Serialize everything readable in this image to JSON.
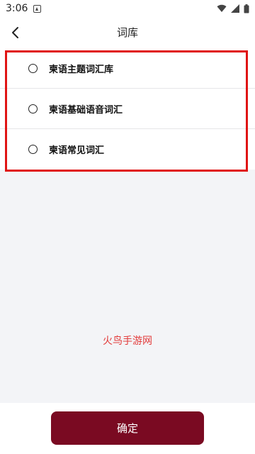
{
  "status_bar": {
    "time": "3:06",
    "icons": [
      "app-notification-icon",
      "wifi-icon",
      "signal-icon",
      "battery-icon"
    ]
  },
  "header": {
    "title": "词库",
    "back_icon": "chevron-left-icon"
  },
  "options": [
    {
      "label": "柬语主题词汇库",
      "selected": false
    },
    {
      "label": "柬语基础语音词汇",
      "selected": false
    },
    {
      "label": "柬语常见词汇",
      "selected": false
    }
  ],
  "watermark": "火鸟手游网",
  "footer": {
    "confirm_label": "确定"
  },
  "colors": {
    "accent": "#7a0a22",
    "highlight": "#e01414",
    "background": "#f3f4f7"
  }
}
